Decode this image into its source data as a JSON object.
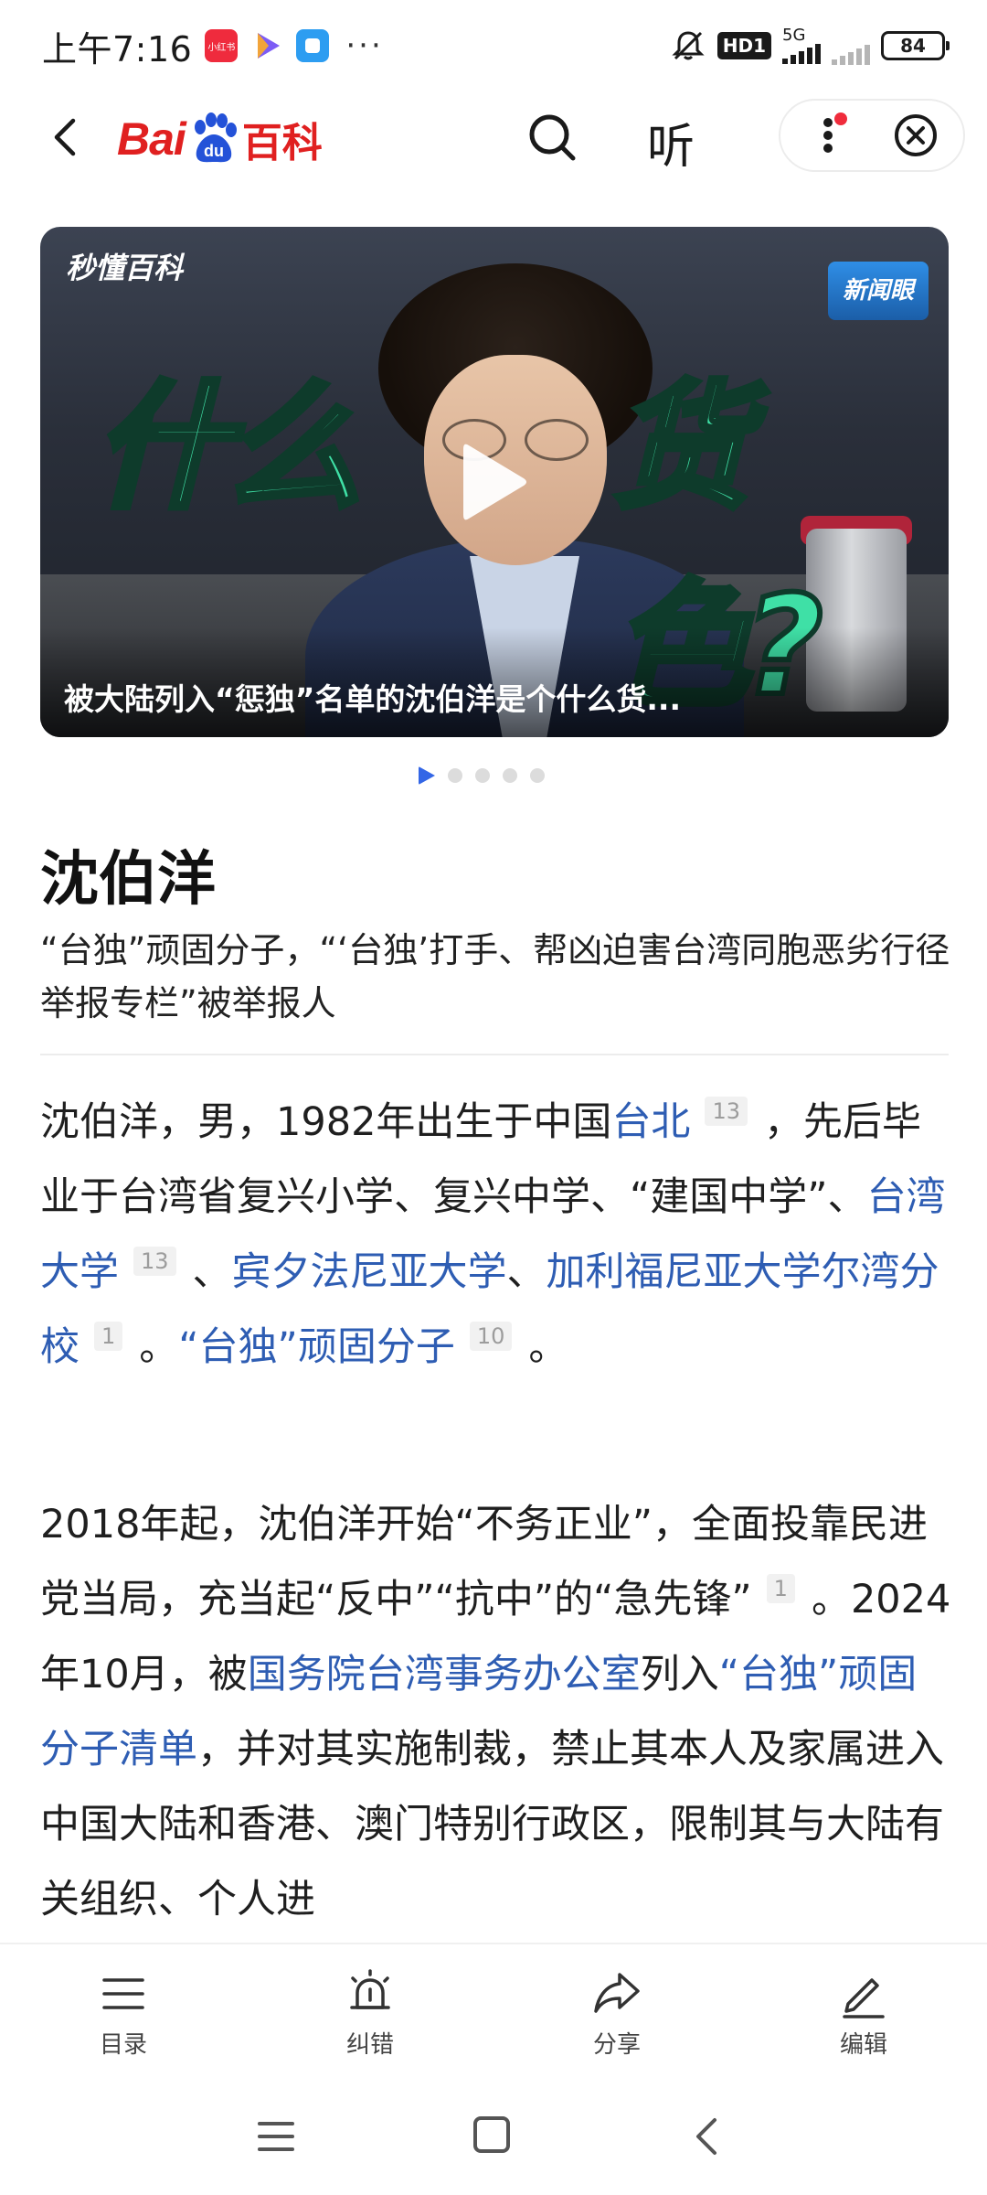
{
  "status_bar": {
    "time": "上午7:16",
    "apps": [
      "小红书-app-icon",
      "video-play-app-icon",
      "chat-app-icon"
    ],
    "more": "···",
    "hd": "HD1",
    "network": "5G",
    "battery": "84"
  },
  "header": {
    "logo_bai": "Bai",
    "logo_du": "du",
    "logo_baike": "百科",
    "listen_label": "听",
    "brand_color": "#e02020"
  },
  "video": {
    "overlay_left": "什么",
    "overlay_right": "货色?",
    "watermark": "秒懂百科",
    "news_badge": "新闻眼",
    "caption": "被大陆列入“惩独”名单的沈伯洋是个什么货...",
    "slides_total": 5,
    "slide_active": 1
  },
  "article": {
    "title": "沈伯洋",
    "subtitle": "“台独”顽固分子，“‘台独’打手、帮凶迫害台湾同胞恶劣行径举报专栏”被举报人",
    "p1": {
      "t1": "沈伯洋，男，1982年出生于中国",
      "l1": "台北",
      "r1": "13",
      "t2": "，先后毕业于台湾省复兴小学、复兴中学、“建国中学”、",
      "l2": "台湾大学",
      "r2": "13",
      "t3": "、",
      "l3": "宾夕法尼亚大学",
      "t4": "、",
      "l4": "加利福尼亚大学尔湾分校",
      "r4": "1",
      "t5": "。",
      "l5": "“台独”顽固分子",
      "r5": "10",
      "t6": "。"
    },
    "p2": {
      "t1": "2018年起，沈伯洋开始“不务正业”，全面投靠民进党当局，充当起“反中”“抗中”的“急先锋”",
      "r1": "1",
      "t2": "。2024年10月，被",
      "l1": "国务院台湾事务办公室",
      "t3": "列入",
      "l2": "“台独”顽固分子清单",
      "t4": "，并对其实施制裁，禁止其本人及家属进入中国大陆和香港、澳门特别行政区，限制其与大陆有关组织、个人进"
    },
    "link_color": "#2e5db3"
  },
  "toolbar": {
    "items": [
      {
        "label": "目录",
        "icon": "list-icon"
      },
      {
        "label": "纠错",
        "icon": "alarm-icon"
      },
      {
        "label": "分享",
        "icon": "share-icon"
      },
      {
        "label": "编辑",
        "icon": "edit-icon"
      }
    ]
  },
  "navbar": {
    "buttons": [
      "menu-icon",
      "home-icon",
      "back-icon"
    ]
  }
}
